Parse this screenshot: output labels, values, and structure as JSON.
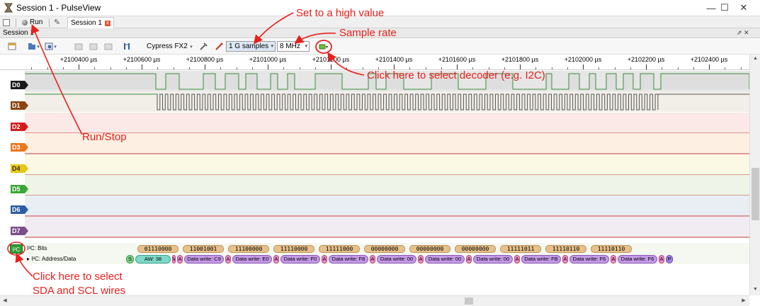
{
  "window": {
    "title": "Session 1 - PulseView",
    "minimize": "—",
    "maximize": "☐",
    "close": "✕"
  },
  "tabbar": {
    "run_label": "Run",
    "session_tab_label": "Session 1",
    "session_tab_close": "x"
  },
  "session_bar": {
    "label": "Session 1",
    "controls": "⇗ ✕"
  },
  "toolbar": {
    "device": "Cypress FX2",
    "sample_count": "1 G samples",
    "sample_rate": "8 MHz"
  },
  "ruler": {
    "unit": "µs",
    "ticks": [
      "+2100400 µs",
      "+2100600 µs",
      "+2100800 µs",
      "+2101000 µs",
      "+2101200 µs",
      "+2101400 µs",
      "+2101600 µs",
      "+2101800 µs",
      "+2102000 µs",
      "+2102200 µs",
      "+2102400 µs"
    ]
  },
  "channels": [
    {
      "name": "D0",
      "color": "#1a1a1a",
      "bg": "#e6e6e6",
      "line": "#3a8e3a"
    },
    {
      "name": "D1",
      "color": "#8b4513",
      "bg": "#f2efe9",
      "line": "#3a8e3a"
    },
    {
      "name": "D2",
      "color": "#d41c1c",
      "bg": "#fbe9e7",
      "line": "#c03a3a"
    },
    {
      "name": "D3",
      "color": "#e8781e",
      "bg": "#fdf0e2",
      "line": "#c03a3a"
    },
    {
      "name": "D4",
      "color": "#e6c619",
      "bg": "#fbf8e3",
      "line": "#c03a3a"
    },
    {
      "name": "D5",
      "color": "#3aa636",
      "bg": "#eef4e8",
      "line": "#c03a3a"
    },
    {
      "name": "D6",
      "color": "#2d5fa6",
      "bg": "#e9eef5",
      "line": "#c03a3a"
    },
    {
      "name": "D7",
      "color": "#7a4d8b",
      "bg": "#f1ecf1",
      "line": "#c03a3a"
    }
  ],
  "decoder": {
    "tag": "I²C",
    "bits_label": "I²C: Bits",
    "addr_label": "I²C: Address/Data",
    "bits": [
      "01110000",
      "11001001",
      "11100000",
      "11110000",
      "11111000",
      "00000000",
      "00000000",
      "00000000",
      "11111011",
      "11110110",
      "11110110"
    ],
    "annotations": [
      {
        "type": "start",
        "text": "S"
      },
      {
        "type": "aw",
        "text": "AW: 38"
      },
      {
        "type": "ack",
        "text": "W"
      },
      {
        "type": "ack",
        "text": "A"
      },
      {
        "type": "data",
        "text": "Data write: C9"
      },
      {
        "type": "ack",
        "text": "A"
      },
      {
        "type": "data",
        "text": "Data write: E0"
      },
      {
        "type": "ack",
        "text": "A"
      },
      {
        "type": "data",
        "text": "Data write: F0"
      },
      {
        "type": "ack",
        "text": "A"
      },
      {
        "type": "data",
        "text": "Data write: F8"
      },
      {
        "type": "ack",
        "text": "A"
      },
      {
        "type": "data",
        "text": "Data write: 00"
      },
      {
        "type": "ack",
        "text": "A"
      },
      {
        "type": "data",
        "text": "Data write: 00"
      },
      {
        "type": "ack",
        "text": "A"
      },
      {
        "type": "data",
        "text": "Data write: 00"
      },
      {
        "type": "ack",
        "text": "A"
      },
      {
        "type": "data",
        "text": "Data write: FB"
      },
      {
        "type": "ack",
        "text": "A"
      },
      {
        "type": "data",
        "text": "Data write: F6"
      },
      {
        "type": "ack",
        "text": "A"
      },
      {
        "type": "data",
        "text": "Data write: F6"
      },
      {
        "type": "ack",
        "text": "A"
      },
      {
        "type": "stop",
        "text": "P"
      }
    ]
  },
  "notes": {
    "high_value": "Set to a high value",
    "sample_rate": "Sample rate",
    "select_decoder": "Click here to select decoder (e.g. I2C)",
    "run_stop": "Run/Stop",
    "select_wires_1": "Click here to select",
    "select_wires_2": "SDA and SCL wires"
  },
  "colors": {
    "annotation_red": "#e8201c"
  }
}
